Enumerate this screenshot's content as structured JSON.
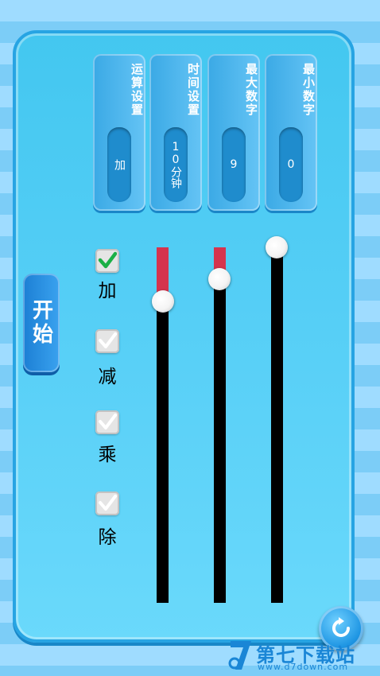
{
  "settings": [
    {
      "title": "最小数字",
      "value": "0"
    },
    {
      "title": "最大数字",
      "value": "9"
    },
    {
      "title": "时间设置",
      "value": "10分钟"
    },
    {
      "title": "运算设置",
      "value": "加"
    }
  ],
  "sliders": [
    {
      "name": "min-number",
      "value_fraction": 0.0,
      "red_fraction": 0.0
    },
    {
      "name": "max-number",
      "value_fraction": 0.087,
      "red_fraction": 0.087
    },
    {
      "name": "time",
      "value_fraction": 0.154,
      "red_fraction": 0.154
    }
  ],
  "operations": [
    {
      "label": "加",
      "checked": true
    },
    {
      "label": "减",
      "checked": false
    },
    {
      "label": "乘",
      "checked": false
    },
    {
      "label": "除",
      "checked": false
    }
  ],
  "start_button": {
    "label": "开始"
  },
  "watermark": {
    "name": "第七下载站",
    "url": "www.d7down.com"
  },
  "colors": {
    "accent_red": "#d5344e",
    "check_green": "#1bb046",
    "panel_blue": "#43c7f0"
  },
  "icons": {
    "refresh": "refresh-icon",
    "checkmark": "check-icon"
  }
}
